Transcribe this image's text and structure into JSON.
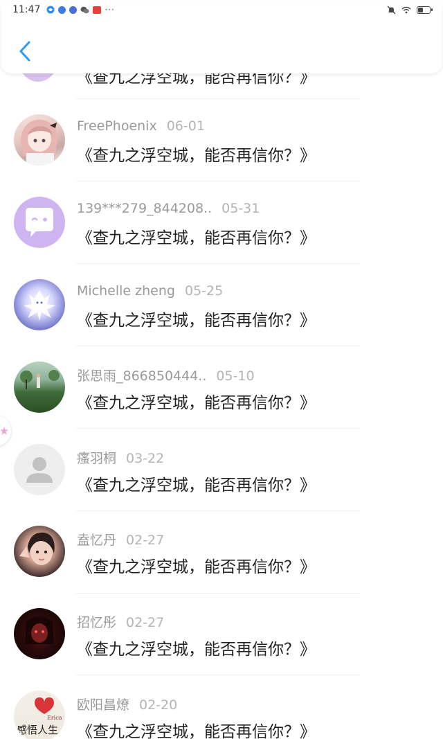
{
  "status_bar": {
    "time": "11:47",
    "dots": "···"
  },
  "header": {
    "back_icon": "chevron-left-icon",
    "accent_color": "#2d9bf0"
  },
  "list": {
    "partial_top_message": "《查九之浮空城，能否再信你？》",
    "items": [
      {
        "name": "FreePhoenix",
        "date": "06-01",
        "message": "《查九之浮空城，能否再信你？》",
        "avatar": "anime-girl-avatar"
      },
      {
        "name": "139***279_844208..",
        "date": "05-31",
        "message": "《查九之浮空城，能否再信你？》",
        "avatar": "chat-bubble-avatar"
      },
      {
        "name": "Michelle zheng",
        "date": "05-25",
        "message": "《查九之浮空城，能否再信你？》",
        "avatar": "white-fox-avatar"
      },
      {
        "name": "张思雨_866850444..",
        "date": "05-10",
        "message": "《查九之浮空城，能否再信你？》",
        "avatar": "park-photo-avatar"
      },
      {
        "name": "瘙羽桐",
        "date": "03-22",
        "message": "《查九之浮空城，能否再信你？》",
        "avatar": "default-user-avatar"
      },
      {
        "name": "盍忆丹",
        "date": "02-27",
        "message": "《查九之浮空城，能否再信你？》",
        "avatar": "girl-selfie-avatar"
      },
      {
        "name": "招忆彤",
        "date": "02-27",
        "message": "《查九之浮空城，能否再信你？》",
        "avatar": "dark-portrait-avatar"
      },
      {
        "name": "欧阳昌燎",
        "date": "02-20",
        "message": "《查九之浮空城，能否再信你？》",
        "avatar": "heart-calligraphy-avatar"
      }
    ]
  },
  "avatar_texts": {
    "heart_avatar_small": "Erica",
    "heart_avatar_big": "感悟人生"
  }
}
